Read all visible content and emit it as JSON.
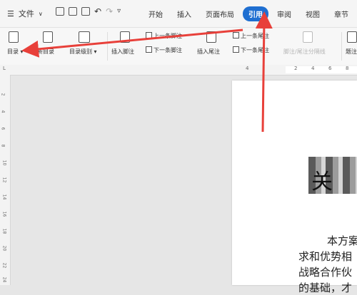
{
  "menu": {
    "icon": "hamburger-icon",
    "file_label": "文件"
  },
  "tabs": [
    {
      "label": "开始",
      "active": false
    },
    {
      "label": "插入",
      "active": false
    },
    {
      "label": "页面布局",
      "active": false
    },
    {
      "label": "引用",
      "active": true
    },
    {
      "label": "审阅",
      "active": false
    },
    {
      "label": "视图",
      "active": false
    },
    {
      "label": "章节",
      "active": false
    }
  ],
  "ribbon": {
    "toc": "目录",
    "update_toc_partial": "新目录",
    "toc_level": "目录级别",
    "insert_footnote": "插入脚注",
    "prev_footnote": "上一条脚注",
    "next_footnote": "下一条脚注",
    "insert_endnote": "插入尾注",
    "prev_endnote": "上一条尾注",
    "next_endnote": "下一条尾注",
    "separator_line": "脚注/尾注分隔线",
    "caption_partial": "题注"
  },
  "ruler": {
    "h_ticks": [
      "4",
      "2",
      "4",
      "6",
      "8"
    ],
    "v_ticks": [
      "2",
      "4",
      "6",
      "8",
      "10",
      "12",
      "14",
      "16",
      "18",
      "20",
      "22",
      "24"
    ]
  },
  "document": {
    "title_partial": "关",
    "lines": [
      "本方案",
      "求和优势相",
      "战略合作伙",
      "的基础，才"
    ]
  },
  "colors": {
    "accent": "#1f6fd1",
    "arrow": "#e8403a"
  }
}
